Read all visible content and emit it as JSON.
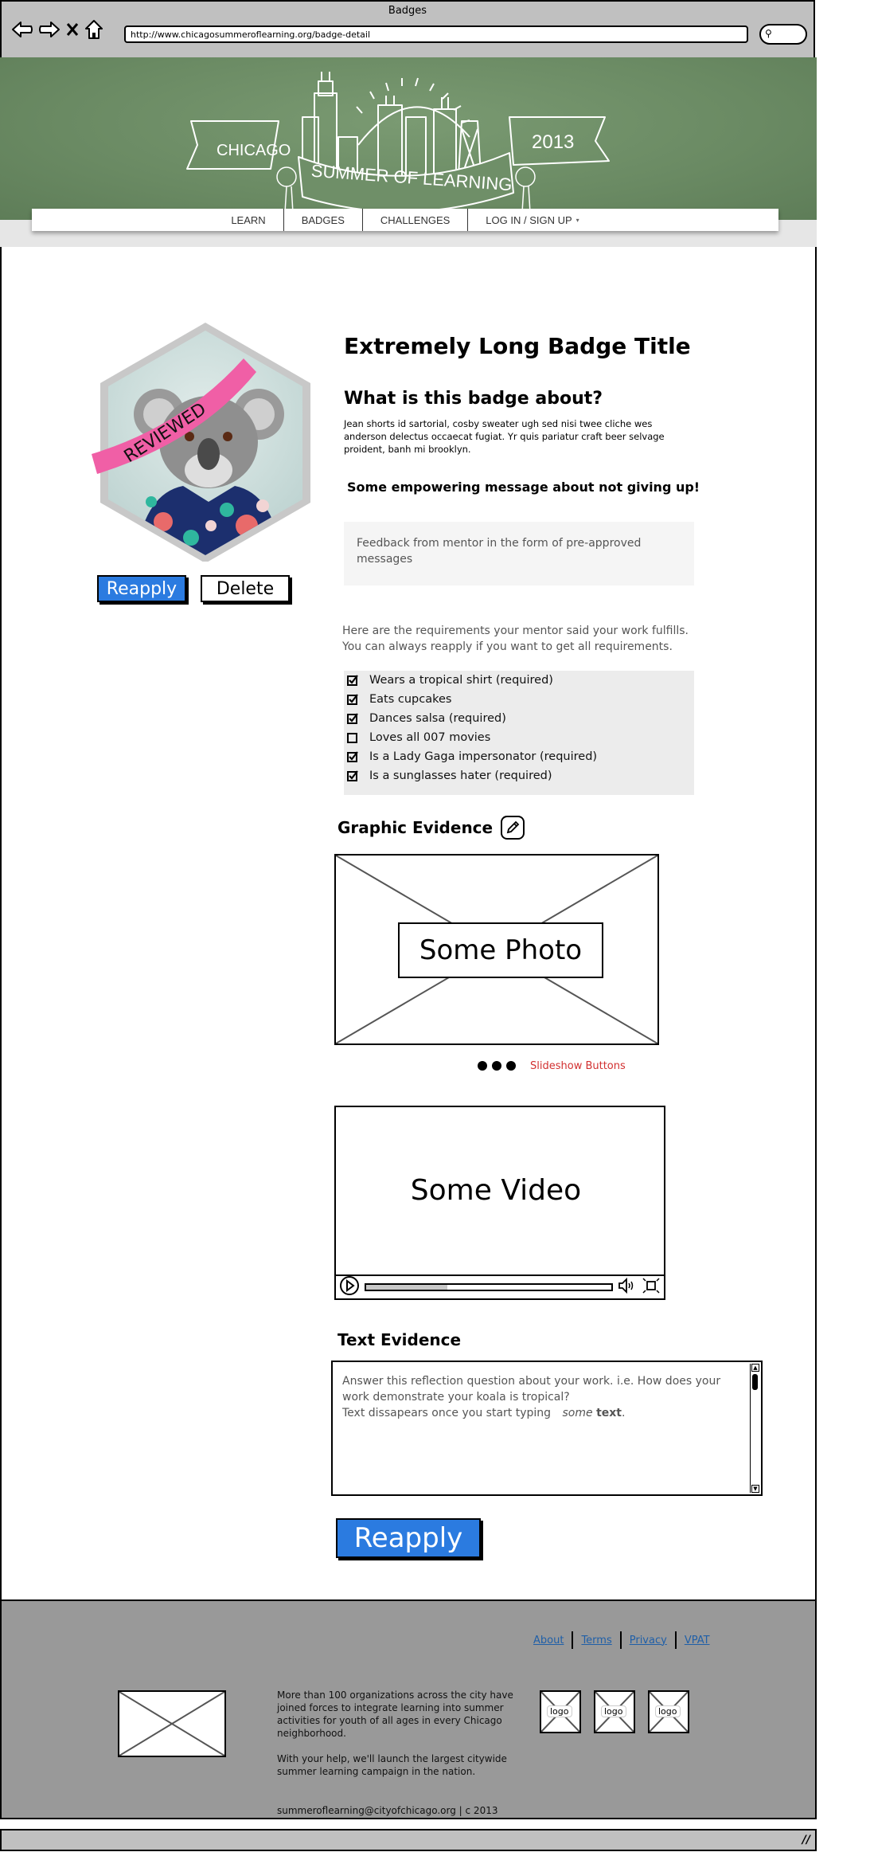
{
  "browser": {
    "window_title": "Badges",
    "url": "http://www.chicagosummeroflearning.org/badge-detail",
    "icons": [
      "back-arrow-icon",
      "forward-arrow-icon",
      "close-x-icon",
      "home-icon",
      "search-icon"
    ]
  },
  "banner": {
    "left_ribbon": "CHICAGO",
    "center_ribbon": "SUMMER OF LEARNING",
    "right_ribbon": "2013"
  },
  "nav": {
    "items": [
      {
        "label": "LEARN"
      },
      {
        "label": "BADGES"
      },
      {
        "label": "CHALLENGES"
      },
      {
        "label": "LOG IN / SIGN UP"
      }
    ],
    "dropdown_caret": "▾"
  },
  "badge": {
    "status_ribbon": "REVIEWED",
    "ribbon_color": "#f05fa6",
    "reapply_label": "Reapply",
    "delete_label": "Delete"
  },
  "main": {
    "title": "Extremely Long Badge Title",
    "about_heading": "What is this badge about?",
    "about_text": "Jean shorts id sartorial, cosby sweater ugh sed nisi twee cliche wes anderson delectus occaecat fugiat. Yr quis pariatur craft beer selvage proident, banh mi brooklyn.",
    "empowering_message": "Some empowering message about not giving up!",
    "mentor_feedback": "Feedback from mentor in the form of pre-approved messages",
    "requirements_intro": "Here are the requirements your mentor said your work fulfills. You can always reapply if you want to get all requirements.",
    "requirements": [
      {
        "label": "Wears a tropical shirt (required)",
        "checked": true
      },
      {
        "label": "Eats cupcakes",
        "checked": true
      },
      {
        "label": "Dances salsa  (required)",
        "checked": true
      },
      {
        "label": "Loves all 007 movies",
        "checked": false
      },
      {
        "label": "Is a Lady Gaga impersonator (required)",
        "checked": true
      },
      {
        "label": "Is a sunglasses hater (required)",
        "checked": true
      }
    ],
    "graphic_evidence_heading": "Graphic Evidence",
    "photo_label": "Some Photo",
    "slideshow_note": "Slideshow Buttons",
    "slideshow_dots": 3,
    "video_label": "Some Video",
    "video_progress": 0.33,
    "text_evidence_heading": "Text Evidence",
    "text_evidence_placeholder_line1": "Answer this reflection question about your work. i.e. How does your work demonstrate your koala is tropical?",
    "text_evidence_placeholder_line2": "Text dissapears once you start typing",
    "text_evidence_italic": "some",
    "text_evidence_bold": "text",
    "text_evidence_end": ".",
    "reapply_label": "Reapply"
  },
  "footer": {
    "links": [
      {
        "label": "About"
      },
      {
        "label": "Terms"
      },
      {
        "label": "Privacy"
      },
      {
        "label": "VPAT"
      }
    ],
    "blurb_1": "More than 100 organizations across the city have joined forces to integrate learning into summer activities for youth of all ages in every Chicago neighborhood.",
    "blurb_2": "With your help, we'll launch the largest citywide summer learning campaign in the nation.",
    "contact": "summeroflearning@cityofchicago.org | c 2013",
    "logos": [
      {
        "label": "logo"
      },
      {
        "label": "logo"
      },
      {
        "label": "logo"
      }
    ]
  },
  "colors": {
    "primary_button": "#2b7be0",
    "banner_green": "#6f8f68",
    "footer_gray": "#999999",
    "annotation_red": "#d23030",
    "link_blue": "#1f5fa8"
  }
}
